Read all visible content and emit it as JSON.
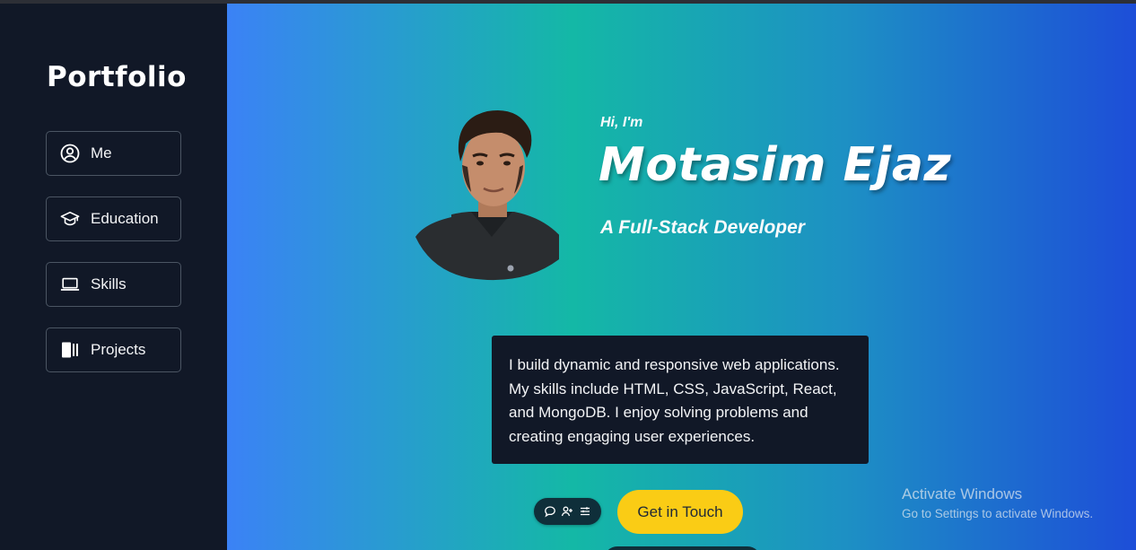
{
  "sidebar": {
    "brand": "Portfolio",
    "items": [
      {
        "label": "Me",
        "icon": "user-circle-icon"
      },
      {
        "label": "Education",
        "icon": "graduation-cap-icon"
      },
      {
        "label": "Skills",
        "icon": "laptop-icon"
      },
      {
        "label": "Projects",
        "icon": "book-icon"
      }
    ]
  },
  "hero": {
    "greeting": "Hi, I'm",
    "name": "Motasim Ejaz",
    "role": "A Full-Stack Developer"
  },
  "about": {
    "text": "I build dynamic and responsive web applications. My skills include HTML, CSS, JavaScript, React, and MongoDB. I enjoy solving problems and creating engaging user experiences."
  },
  "actions": {
    "cta_label": "Get in Touch"
  },
  "floating_toolbar": {
    "icons": [
      "chat-bubble-icon",
      "add-user-icon",
      "menu-lines-icon"
    ]
  },
  "watermark": {
    "line1": "Activate Windows",
    "line2": "Go to Settings to activate Windows."
  },
  "colors": {
    "sidebar_bg": "#111827",
    "accent_yellow": "#facc15",
    "gradient_start": "#3b82f6",
    "gradient_mid": "#14b8a6",
    "gradient_end": "#1d4ed8"
  }
}
